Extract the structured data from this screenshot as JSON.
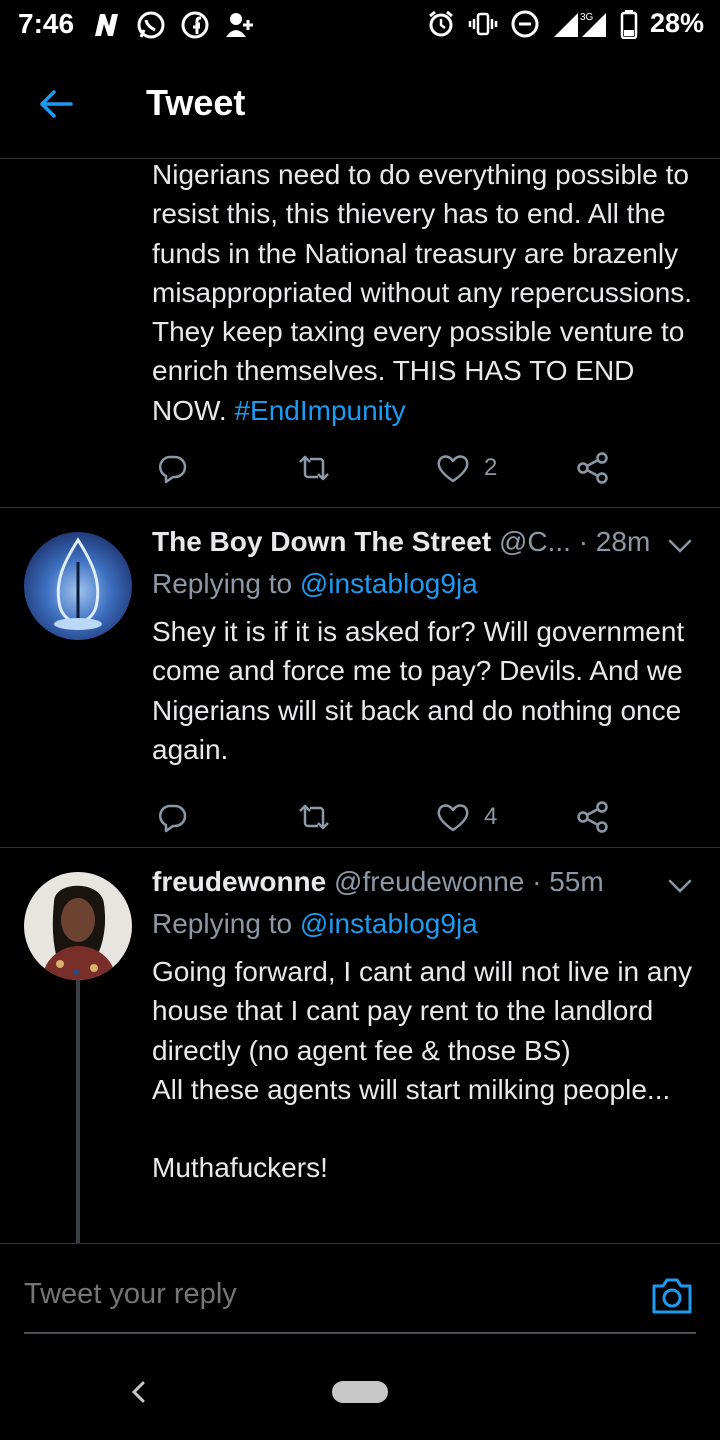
{
  "status_bar": {
    "time": "7:46",
    "left_icons": [
      "n-icon",
      "whatsapp-icon",
      "facebook-icon",
      "add-user-icon"
    ],
    "right_icons": [
      "alarm-icon",
      "vibrate-icon",
      "dnd-icon",
      "signal-icon"
    ],
    "network": "3G",
    "battery_percent": "28%"
  },
  "header": {
    "title": "Tweet"
  },
  "tweets": [
    {
      "text": "Nigerians need to do everything possible to resist this, this thievery has to end. All the funds in the National treasury are brazenly misappropriated without any repercussions. They keep taxing every possible venture to enrich themselves. THIS HAS TO END NOW. ",
      "hashtag": "#EndImpunity",
      "likes": "2"
    },
    {
      "name": "The Boy Down The Street",
      "handle": "@C...",
      "time": "· 28m",
      "replying_prefix": "Replying to",
      "replying_to": "@instablog9ja",
      "text": "Shey it is if it is asked for? Will government come and force me to pay? Devils. And we Nigerians will sit back and do nothing once again.",
      "likes": "4"
    },
    {
      "name": "freudewonne",
      "handle": "@freudewonne",
      "time": "· 55m",
      "replying_prefix": "Replying to",
      "replying_to": "@instablog9ja",
      "text": "Going forward, I cant and will not live in any house that I cant pay rent to the landlord directly (no agent fee & those BS)\nAll these agents will start milking people...\n\nMuthafuckers!"
    }
  ],
  "reply_bar": {
    "placeholder": "Tweet your reply"
  },
  "colors": {
    "accent": "#1d9bf0",
    "background": "#000000",
    "muted": "#8b98a5"
  }
}
